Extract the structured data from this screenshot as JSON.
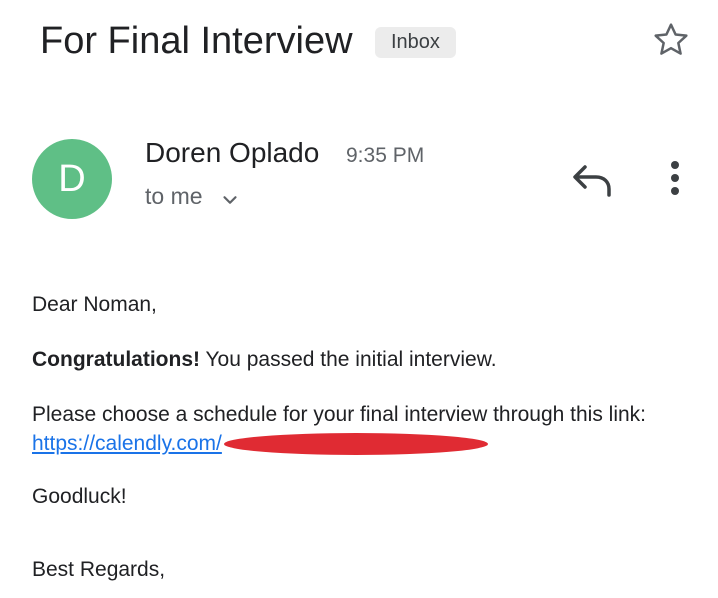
{
  "email": {
    "subject": "For Final Interview",
    "label": "Inbox",
    "sender": {
      "initial": "D",
      "name": "Doren Oplado",
      "time": "9:35 PM",
      "recipient": "to me"
    },
    "body": {
      "greeting": "Dear Noman,",
      "congrats_bold": "Congratulations!",
      "congrats_rest": " You passed the initial interview.",
      "schedule_line": "Please choose a schedule for your final interview through this link:",
      "link_visible": "https://calendly.com/",
      "goodluck": "Goodluck!",
      "signoff": "Best Regards,"
    }
  },
  "icons": {
    "star": "star-outline-icon",
    "chevron": "chevron-down-icon",
    "reply": "reply-icon",
    "more": "more-vert-icon"
  },
  "colors": {
    "avatar": "#5fbf86",
    "link": "#1a73e8",
    "redaction": "#e02b33",
    "chip_background": "#ececec"
  }
}
